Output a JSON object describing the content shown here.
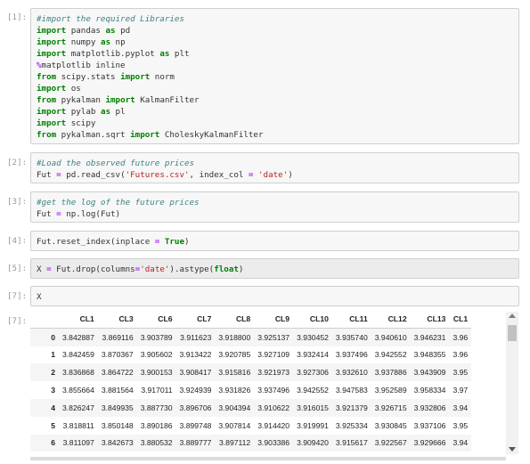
{
  "cells": [
    {
      "prompt": "[1]:",
      "lines": [
        [
          [
            "cm",
            "#import the required Libraries"
          ]
        ],
        [
          [
            "kw",
            "import"
          ],
          [
            "var",
            " pandas "
          ],
          [
            "kw",
            "as"
          ],
          [
            "var",
            " pd"
          ]
        ],
        [
          [
            "kw",
            "import"
          ],
          [
            "var",
            " numpy "
          ],
          [
            "kw",
            "as"
          ],
          [
            "var",
            " np"
          ]
        ],
        [
          [
            "kw",
            "import"
          ],
          [
            "var",
            " matplotlib.pyplot "
          ],
          [
            "kw",
            "as"
          ],
          [
            "var",
            " plt"
          ]
        ],
        [
          [
            "op",
            "%"
          ],
          [
            "var",
            "matplotlib inline"
          ]
        ],
        [
          [
            "kw",
            "from"
          ],
          [
            "var",
            " scipy.stats "
          ],
          [
            "kw",
            "import"
          ],
          [
            "var",
            " norm"
          ]
        ],
        [
          [
            "kw",
            "import"
          ],
          [
            "var",
            " os"
          ]
        ],
        [
          [
            "kw",
            "from"
          ],
          [
            "var",
            " pykalman "
          ],
          [
            "kw",
            "import"
          ],
          [
            "var",
            " KalmanFilter"
          ]
        ],
        [
          [
            "kw",
            "import"
          ],
          [
            "var",
            " pylab "
          ],
          [
            "kw",
            "as"
          ],
          [
            "var",
            " pl"
          ]
        ],
        [
          [
            "kw",
            "import"
          ],
          [
            "var",
            " scipy"
          ]
        ],
        [
          [
            "kw",
            "from"
          ],
          [
            "var",
            " pykalman.sqrt "
          ],
          [
            "kw",
            "import"
          ],
          [
            "var",
            " CholeskyKalmanFilter"
          ]
        ]
      ]
    },
    {
      "prompt": "[2]:",
      "lines": [
        [
          [
            "cm",
            "#Load the observed future prices"
          ]
        ],
        [
          [
            "var",
            "Fut "
          ],
          [
            "op",
            "="
          ],
          [
            "var",
            " pd.read_csv("
          ],
          [
            "str",
            "'Futures.csv'"
          ],
          [
            "var",
            ", index_col "
          ],
          [
            "op",
            "="
          ],
          [
            "var",
            " "
          ],
          [
            "str",
            "'date'"
          ],
          [
            "var",
            ")"
          ]
        ]
      ]
    },
    {
      "prompt": "[3]:",
      "lines": [
        [
          [
            "cm",
            "#get the log of the future prices"
          ]
        ],
        [
          [
            "var",
            "Fut "
          ],
          [
            "op",
            "="
          ],
          [
            "var",
            " np.log(Fut)"
          ]
        ]
      ]
    },
    {
      "prompt": "[4]:",
      "lines": [
        [
          [
            "var",
            "Fut.reset_index(inplace "
          ],
          [
            "op",
            "="
          ],
          [
            "var",
            " "
          ],
          [
            "kw",
            "True"
          ],
          [
            "var",
            ")"
          ]
        ]
      ]
    },
    {
      "prompt": "[5]:",
      "lines": [
        [
          [
            "var",
            "X "
          ],
          [
            "op",
            "="
          ],
          [
            "var",
            " Fut.drop(columns"
          ],
          [
            "op",
            "="
          ],
          [
            "str",
            "'date'"
          ],
          [
            "var",
            ").astype("
          ],
          [
            "kw",
            "float"
          ],
          [
            "var",
            ")"
          ]
        ]
      ]
    },
    {
      "prompt": "[7]:",
      "lines": [
        [
          [
            "var",
            "X"
          ]
        ]
      ]
    }
  ],
  "output": {
    "prompt": "[7]:",
    "columns": [
      "CL1",
      "CL3",
      "CL6",
      "CL7",
      "CL8",
      "CL9",
      "CL10",
      "CL11",
      "CL12",
      "CL13",
      "CL1"
    ],
    "rows": [
      {
        "index": "0",
        "values": [
          "3.842887",
          "3.869116",
          "3.903789",
          "3.911623",
          "3.918800",
          "3.925137",
          "3.930452",
          "3.935740",
          "3.940610",
          "3.946231",
          "3.96"
        ]
      },
      {
        "index": "1",
        "values": [
          "3.842459",
          "3.870367",
          "3.905602",
          "3.913422",
          "3.920785",
          "3.927109",
          "3.932414",
          "3.937496",
          "3.942552",
          "3.948355",
          "3.96"
        ]
      },
      {
        "index": "2",
        "values": [
          "3.836868",
          "3.864722",
          "3.900153",
          "3.908417",
          "3.915816",
          "3.921973",
          "3.927306",
          "3.932610",
          "3.937886",
          "3.943909",
          "3.95"
        ]
      },
      {
        "index": "3",
        "values": [
          "3.855664",
          "3.881564",
          "3.917011",
          "3.924939",
          "3.931826",
          "3.937496",
          "3.942552",
          "3.947583",
          "3.952589",
          "3.958334",
          "3.97"
        ]
      },
      {
        "index": "4",
        "values": [
          "3.826247",
          "3.849935",
          "3.887730",
          "3.896706",
          "3.904394",
          "3.910622",
          "3.916015",
          "3.921379",
          "3.926715",
          "3.932806",
          "3.94"
        ]
      },
      {
        "index": "5",
        "values": [
          "3.818811",
          "3.850148",
          "3.890186",
          "3.899748",
          "3.907814",
          "3.914420",
          "3.919991",
          "3.925334",
          "3.930845",
          "3.937106",
          "3.95"
        ]
      },
      {
        "index": "6",
        "values": [
          "3.811097",
          "3.842673",
          "3.880532",
          "3.889777",
          "3.897112",
          "3.903386",
          "3.909420",
          "3.915617",
          "3.922567",
          "3.929666",
          "3.94"
        ]
      }
    ]
  }
}
